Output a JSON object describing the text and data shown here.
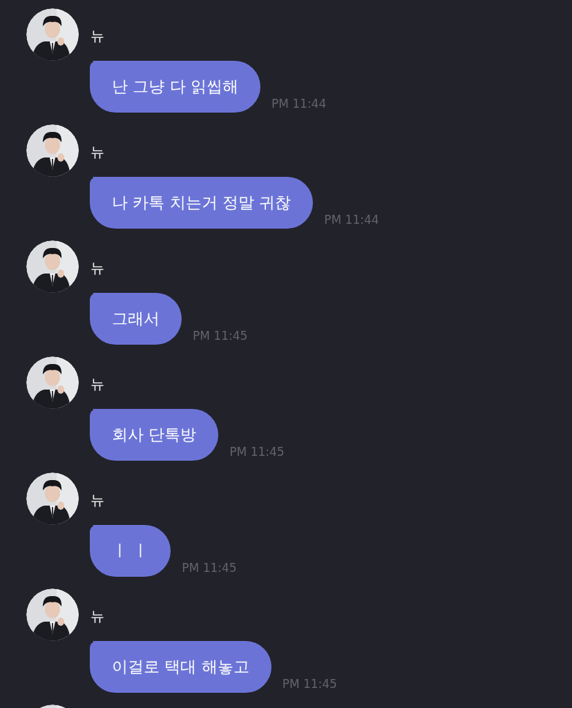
{
  "messages": [
    {
      "sender": "뉴",
      "text": "난 그냥 다 읽씹해",
      "time": "PM 11:44"
    },
    {
      "sender": "뉴",
      "text": "나 카톡 치는거 정말 귀찮",
      "time": "PM 11:44"
    },
    {
      "sender": "뉴",
      "text": "그래서",
      "time": "PM 11:45"
    },
    {
      "sender": "뉴",
      "text": "회사 단톡방",
      "time": "PM 11:45"
    },
    {
      "sender": "뉴",
      "text": "ㅣ ㅣ",
      "time": "PM 11:45"
    },
    {
      "sender": "뉴",
      "text": "이걸로 택대 해놓고",
      "time": "PM 11:45"
    }
  ]
}
